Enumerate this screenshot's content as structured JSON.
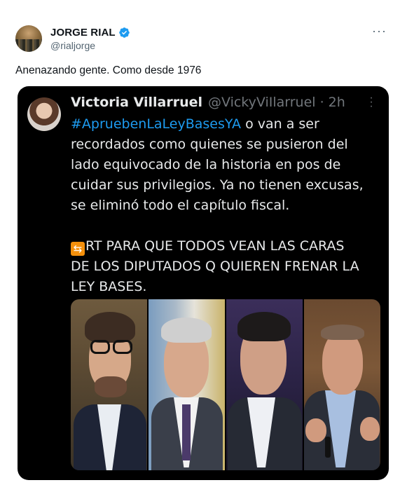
{
  "tweet": {
    "author": {
      "display_name": "JORGE RIAL",
      "handle": "@rialjorge",
      "verified_color": "#1d9bf0"
    },
    "more_label": "···",
    "text": "Anenazando gente. Como desde 1976"
  },
  "quoted": {
    "author": {
      "display_name": "Victoria Villarruel",
      "handle": "@VickyViIlarruel",
      "separator": "·",
      "time": "2h"
    },
    "more_label": "⋮",
    "hashtag": "#ApruebenLaLeyBasesYA",
    "lines": [
      " o van a ser",
      "recordados como quienes se pusieron del",
      "lado equivocado de la historia en pos de",
      "cuidar sus privilegios. Ya no tienen excusas,",
      "se eliminó todo el capítulo fiscal."
    ],
    "rt_emoji": "🔁",
    "rt_lines": [
      "RT PARA QUE TODOS VEAN LAS CARAS",
      "DE LOS DIPUTADOS Q QUIEREN FRENAR LA",
      "LEY BASES."
    ],
    "hashtag_color": "#1d9bf0",
    "photos": [
      {
        "icon": "person-photo-glasses"
      },
      {
        "icon": "person-photo-gray-hair"
      },
      {
        "icon": "person-photo-dark-hair"
      },
      {
        "icon": "person-photo-speaking"
      }
    ]
  }
}
